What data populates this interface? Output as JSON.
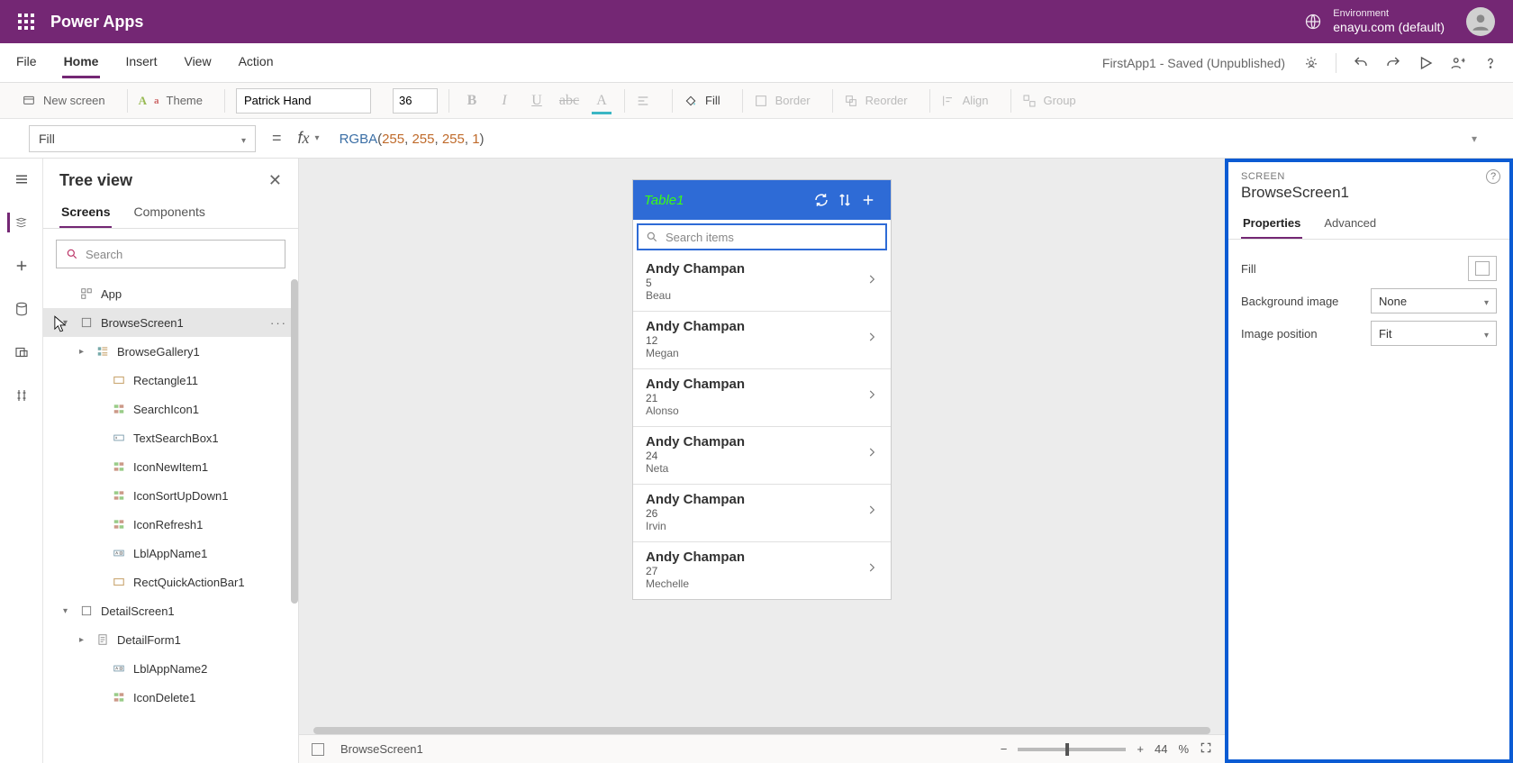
{
  "header": {
    "product": "Power Apps",
    "env_label": "Environment",
    "env_value": "enayu.com (default)"
  },
  "menubar": {
    "items": [
      "File",
      "Home",
      "Insert",
      "View",
      "Action"
    ],
    "active": "Home",
    "doctitle": "FirstApp1 - Saved (Unpublished)"
  },
  "ribbon": {
    "new_screen": "New screen",
    "theme": "Theme",
    "font": "Patrick Hand",
    "size": "36",
    "fill": "Fill",
    "border": "Border",
    "reorder": "Reorder",
    "align": "Align",
    "group": "Group"
  },
  "formula": {
    "property": "Fill",
    "fn": "RGBA",
    "args": [
      "255",
      "255",
      "255",
      "1"
    ]
  },
  "treeview": {
    "title": "Tree view",
    "tabs": [
      "Screens",
      "Components"
    ],
    "active": "Screens",
    "search_placeholder": "Search",
    "nodes": [
      {
        "depth": 0,
        "label": "App",
        "caret": "",
        "icon": "app",
        "selected": false
      },
      {
        "depth": 0,
        "label": "BrowseScreen1",
        "caret": "v",
        "icon": "screen",
        "selected": true
      },
      {
        "depth": 1,
        "label": "BrowseGallery1",
        "caret": ">",
        "icon": "gallery"
      },
      {
        "depth": 2,
        "label": "Rectangle11",
        "icon": "rect"
      },
      {
        "depth": 2,
        "label": "SearchIcon1",
        "icon": "iconctl"
      },
      {
        "depth": 2,
        "label": "TextSearchBox1",
        "icon": "textbox"
      },
      {
        "depth": 2,
        "label": "IconNewItem1",
        "icon": "iconctl"
      },
      {
        "depth": 2,
        "label": "IconSortUpDown1",
        "icon": "iconctl"
      },
      {
        "depth": 2,
        "label": "IconRefresh1",
        "icon": "iconctl"
      },
      {
        "depth": 2,
        "label": "LblAppName1",
        "icon": "label"
      },
      {
        "depth": 2,
        "label": "RectQuickActionBar1",
        "icon": "rect"
      },
      {
        "depth": 0,
        "label": "DetailScreen1",
        "caret": "v",
        "icon": "screen"
      },
      {
        "depth": 1,
        "label": "DetailForm1",
        "caret": ">",
        "icon": "form"
      },
      {
        "depth": 2,
        "label": "LblAppName2",
        "icon": "label"
      },
      {
        "depth": 2,
        "label": "IconDelete1",
        "icon": "iconctl"
      }
    ]
  },
  "phone": {
    "title": "Table1",
    "search_placeholder": "Search items",
    "items": [
      {
        "name": "Andy Champan",
        "n": "5",
        "sub": "Beau"
      },
      {
        "name": "Andy Champan",
        "n": "12",
        "sub": "Megan"
      },
      {
        "name": "Andy Champan",
        "n": "21",
        "sub": "Alonso"
      },
      {
        "name": "Andy Champan",
        "n": "24",
        "sub": "Neta"
      },
      {
        "name": "Andy Champan",
        "n": "26",
        "sub": "Irvin"
      },
      {
        "name": "Andy Champan",
        "n": "27",
        "sub": "Mechelle"
      }
    ]
  },
  "status": {
    "screen": "BrowseScreen1",
    "zoom": "44",
    "zoom_unit": "%"
  },
  "props": {
    "type": "SCREEN",
    "name": "BrowseScreen1",
    "tabs": [
      "Properties",
      "Advanced"
    ],
    "active": "Properties",
    "labels": {
      "fill": "Fill",
      "bg": "Background image",
      "pos": "Image position"
    },
    "values": {
      "bg": "None",
      "pos": "Fit"
    }
  }
}
